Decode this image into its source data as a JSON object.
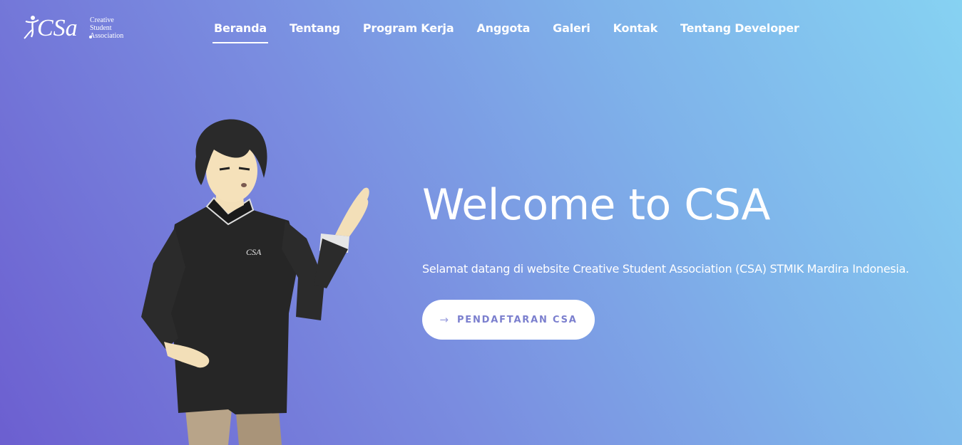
{
  "logo": {
    "mark": "CSa",
    "line1": "Creative",
    "line2": "Student",
    "line3": "Association"
  },
  "nav": {
    "items": [
      {
        "label": "Beranda",
        "active": true
      },
      {
        "label": "Tentang"
      },
      {
        "label": "Program Kerja"
      },
      {
        "label": "Anggota"
      },
      {
        "label": "Galeri"
      },
      {
        "label": "Kontak"
      },
      {
        "label": "Tentang Developer"
      }
    ]
  },
  "hero": {
    "title": "Welcome to CSA",
    "subtitle": "Selamat datang di website Creative Student Association (CSA) STMIK Mardira Indonesia.",
    "cta_label": "PENDAFTARAN CSA",
    "cta_icon": "arrow-right-icon",
    "shirt_logo": "CSA"
  },
  "colors": {
    "gradient_start": "#6c5fd0",
    "gradient_end": "#86d2f2",
    "cta_text": "#7b7fce"
  }
}
